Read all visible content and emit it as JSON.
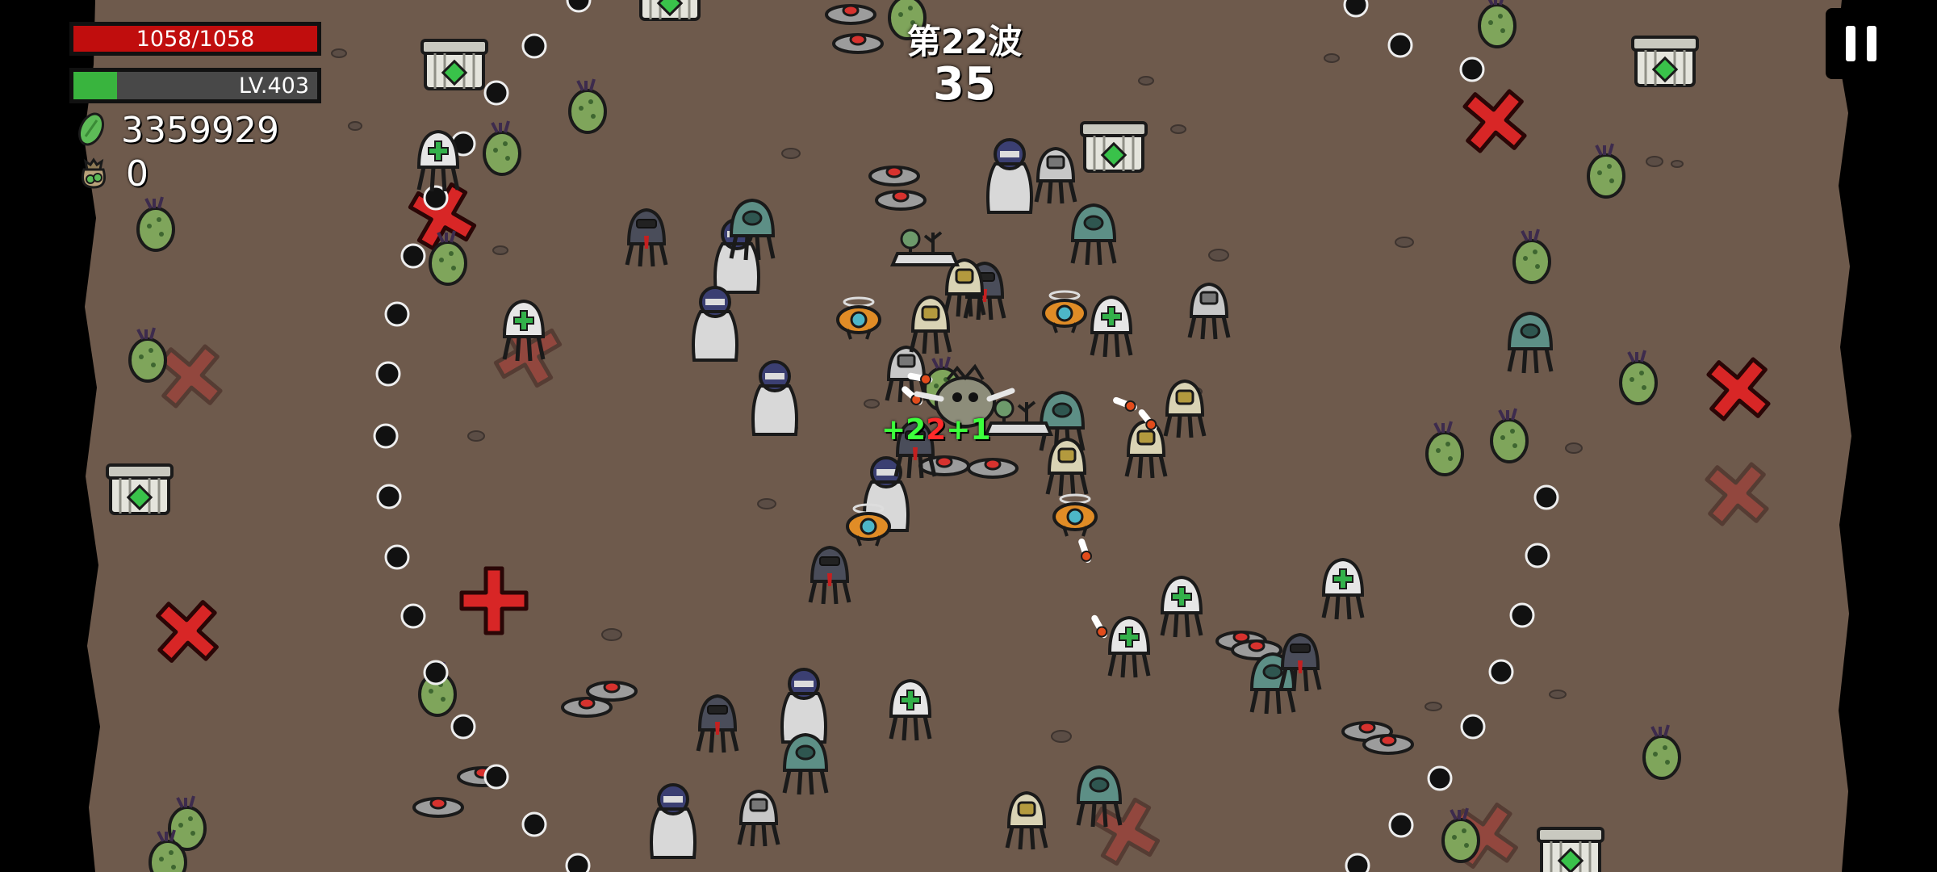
{
  "hud": {
    "hp_text": "1058/1058",
    "hp_fraction": 1.0,
    "level_text": "LV.403",
    "xp_fraction": 0.18,
    "materials_value": "3359929",
    "bag_value": "0"
  },
  "wave": {
    "label": "第22波",
    "timer": "35"
  },
  "floating_numbers": [
    {
      "text": "+2",
      "color": "#3cff3c"
    },
    {
      "text": "2",
      "color": "#ff2a2a"
    },
    {
      "text": "+1",
      "color": "#3cff3c"
    }
  ],
  "icons": {
    "material": "green-seed-icon",
    "bag": "money-bag-icon",
    "pause": "pause-icon"
  },
  "colors": {
    "ground": "#6e5a4c",
    "hp": "#c00d0d",
    "xp": "#39b43e"
  }
}
